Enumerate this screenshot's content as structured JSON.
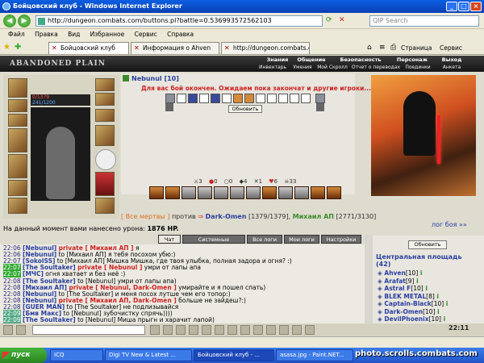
{
  "window": {
    "title": "Бойцовский клуб - Windows Internet Explorer"
  },
  "address": {
    "url": "http://dungeon.combats.com/buttons.pl?battle=0.536993572562103",
    "search_placeholder": "QIP Search"
  },
  "menu": [
    "Файл",
    "Правка",
    "Вид",
    "Избранное",
    "Сервис",
    "Справка"
  ],
  "tabs": [
    "Бойцовский клуб",
    "Информация о Ahven",
    "http://dungeon.combats.com/..."
  ],
  "toolbar": {
    "page": "Страница",
    "tools": "Сервис"
  },
  "game": {
    "logo": "ABANDONED PLAIN",
    "top_menu": [
      "Знания",
      "Общение",
      "Безопасность",
      "Персонаж",
      "Выход"
    ],
    "sub_menu": [
      "Инвентарь",
      "Умения",
      "Мой Скролл",
      "Отчет о переводах",
      "Поединки",
      "Анкета"
    ],
    "hp": "0/1379",
    "mana": "241/1200",
    "player_name": "Nebunul [10]",
    "wait_message": "Для вас бой окончен. Ожидаем пока закончат и другие игроки...",
    "refresh_label": "Обновить",
    "stats": [
      "3",
      "0",
      "0",
      "4",
      "1",
      "6",
      "33"
    ],
    "all_dead": "[ Все мертвы ]",
    "versus": "против",
    "enemy1": "Dark-Omen",
    "enemy1_hp": "[1379/1379]",
    "enemy2": "Михаил АП",
    "enemy2_hp": "[2771/3130]",
    "log_link": "лог боя »»",
    "damage_text": "На данный момент вами нанесено урона:",
    "damage_value": "1876 HP."
  },
  "chat": {
    "tabs": [
      "Чат",
      "Системные сообщения",
      "Все логи",
      "Мои логи",
      "Настройки"
    ],
    "lines": [
      {
        "time": "22:06",
        "sender": "[Nebunul]",
        "private": "private [ Михаил АП ]",
        "text": " я"
      },
      {
        "time": "22:06",
        "sender": "[Nebunul]",
        "private": "",
        "text": " to [Михаил АП] я тебя посохом убю:)"
      },
      {
        "time": "22:07",
        "sender": "[SokolSS]",
        "private": "",
        "text": " to [Михаил АП] Мишка Мишка, где твоя улыбка, полная задора и огня? :)"
      },
      {
        "time": "22:07",
        "sender": "[The Soultaker]",
        "private": "private [ Nebunul ]",
        "text": " умри от лапы апа"
      },
      {
        "time": "22:07",
        "sender": "[МЧС]",
        "private": "",
        "text": " огня хватает и без неё :)"
      },
      {
        "time": "22:08",
        "sender": "[The Soultaker]",
        "private": "",
        "text": " to [Nebunul] умри от лапы апа)"
      },
      {
        "time": "22:08",
        "sender": "[Михаил АП]",
        "private": "private [ Nebunul, Dark-Omen ]",
        "text": " умирайте и я пошел спать)"
      },
      {
        "time": "22:08",
        "sender": "[Nebunul]",
        "private": "",
        "text": " to [The Soultaker] и меня посох лутше чем его топор:)"
      },
      {
        "time": "22:08",
        "sender": "[Nebunul]",
        "private": "private [ Михаил АП, Dark-Omen ]",
        "text": " больше не зайдеш?:)"
      },
      {
        "time": "22:08",
        "sender": "[GUER MAN]",
        "private": "",
        "text": " to [The Soultaker] не подлизывайся"
      },
      {
        "time": "22:09",
        "sender": "[Бмв Макс]",
        "private": "",
        "text": " to [Nebunul] зубочистку спрячь))))"
      },
      {
        "time": "22:09",
        "sender": "[The Soultaker]",
        "private": "",
        "text": " to [Nebunul] Миша прыгн и харачит лапой)"
      }
    ]
  },
  "sidepanel": {
    "refresh_label": "Обновить",
    "location": "Центральная площадь",
    "count": "(42)",
    "users": [
      {
        "name": "Ahven",
        "level": "[10]"
      },
      {
        "name": "Arafat",
        "level": "[9]"
      },
      {
        "name": "Astral F",
        "level": "[10]"
      },
      {
        "name": "BLEK METAL",
        "level": "[8]"
      },
      {
        "name": "Captain-Black",
        "level": "[10]"
      },
      {
        "name": "Dark-Omen",
        "level": "[10]"
      },
      {
        "name": "DevilPhoenix",
        "level": "[10]"
      }
    ]
  },
  "clock": "22:11",
  "taskbar": {
    "start": "пуск",
    "tasks": [
      "ICQ",
      "Digi TV New & Latest ...",
      "Бойцовский клуб - ...",
      "asasa.jpg - Paint.NET..."
    ]
  },
  "watermark": "photo.scrolls.combats.com",
  "colors": {
    "accent": "#2a3fa0",
    "alert": "#cc2222",
    "green": "#3a8a2a"
  }
}
